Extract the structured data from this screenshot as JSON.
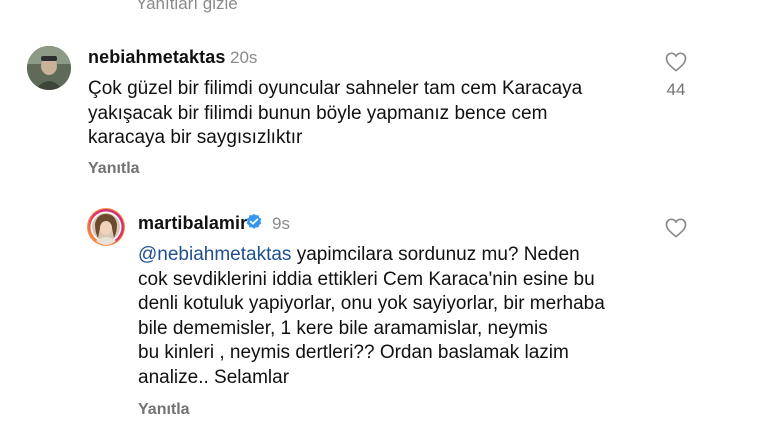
{
  "top_partial_text": "Yanıtları gizle",
  "comment": {
    "username": "nebiahmetaktas",
    "time": "20s",
    "text_lines": [
      "Çok güzel bir filimdi oyuncular sahneler tam cem Karacaya",
      "yakışacak bir filimdi bunun böyle yapmanız bence cem",
      "karacaya bir saygısızlıktır"
    ],
    "reply_label": "Yanıtla",
    "likes": "44"
  },
  "reply": {
    "username": "martibalamir",
    "time": "9s",
    "mention": "@nebiahmetaktas",
    "first_line_rest": " yapimcilara sordunuz mu? Neden",
    "text_lines": [
      "cok sevdiklerini iddia ettikleri Cem Karaca'nin esine bu",
      "denli kotuluk yapiyorlar, onu yok sayiyorlar, bir merhaba",
      "bile dememisler, 1 kere bile aramamislar, neymis",
      "bu kinleri , neymis dertleri?? Ordan baslamak lazim",
      "analize.. Selamlar"
    ],
    "reply_label": "Yanıtla"
  },
  "icons": {
    "like": "heart-outline-icon",
    "verified": "verified-badge-icon"
  },
  "colors": {
    "verified": "#3797f0",
    "mention": "#1f4f8f",
    "secondary_text": "#737373"
  }
}
